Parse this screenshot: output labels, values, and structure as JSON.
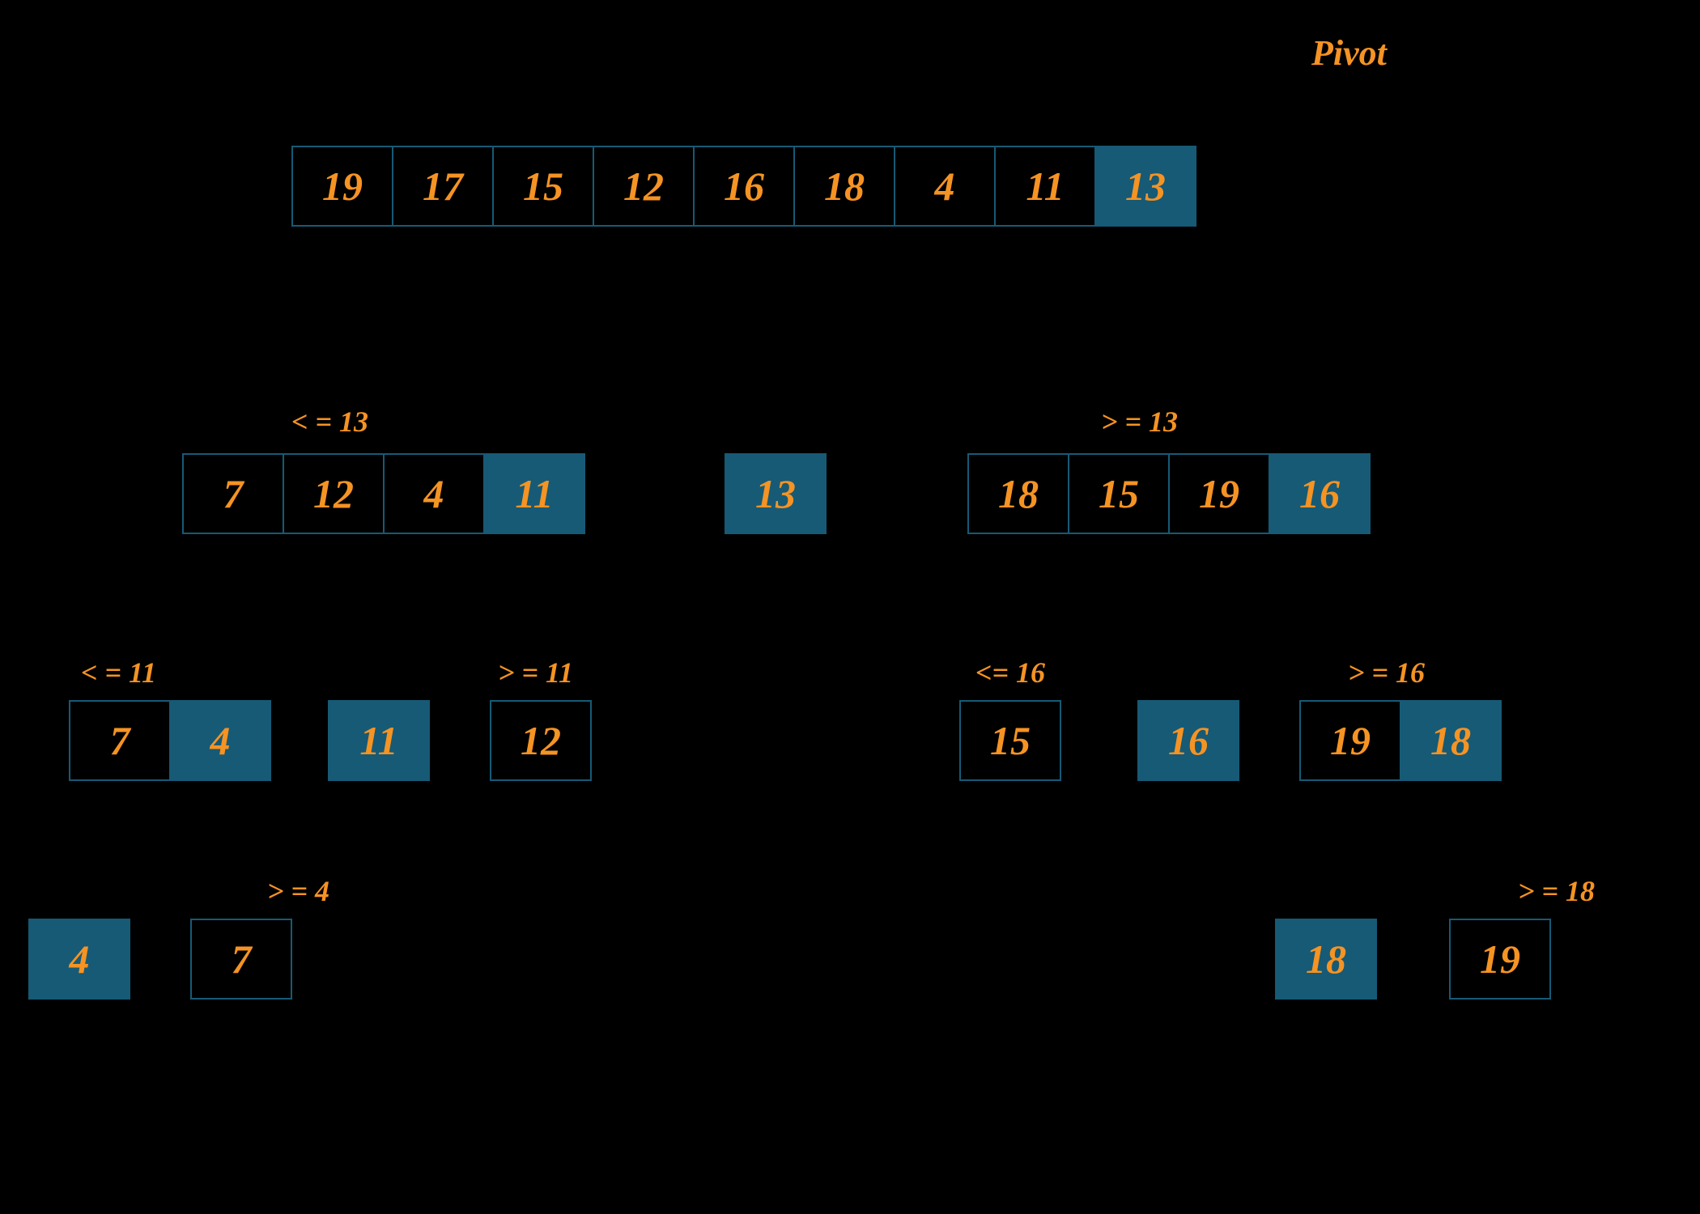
{
  "title": "Pivot",
  "level0": {
    "cells": [
      "19",
      "17",
      "15",
      "12",
      "16",
      "18",
      "4",
      "11",
      "13"
    ]
  },
  "level1": {
    "left": {
      "label": "< = 13",
      "cells": [
        "7",
        "12",
        "4",
        "11"
      ]
    },
    "mid": "13",
    "right": {
      "label": "> = 13",
      "cells": [
        "18",
        "15",
        "19",
        "16"
      ]
    }
  },
  "level2": {
    "l_left": {
      "label": "< = 11",
      "cells": [
        "7",
        "4"
      ]
    },
    "l_mid": "11",
    "l_right": {
      "label": "> = 11",
      "cells": [
        "12"
      ]
    },
    "r_left": {
      "label": "<= 16",
      "cells": [
        "15"
      ]
    },
    "r_mid": "16",
    "r_right": {
      "label": "> = 16",
      "cells": [
        "19",
        "18"
      ]
    }
  },
  "level3": {
    "ll_left": "4",
    "ll_right": {
      "label": "> = 4",
      "cells": [
        "7"
      ]
    },
    "rr_left": "18",
    "rr_right": {
      "label": "> = 18",
      "cells": [
        "19"
      ]
    }
  }
}
